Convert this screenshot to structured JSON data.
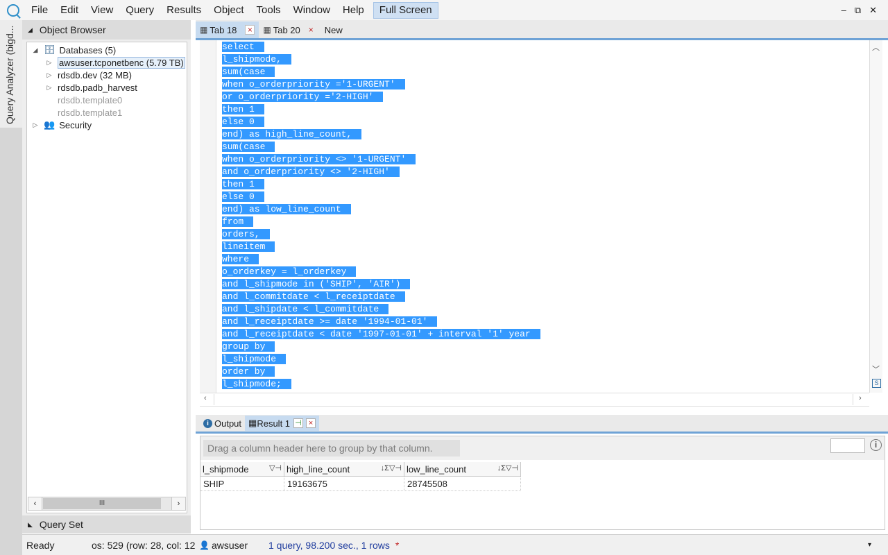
{
  "menu": {
    "items": [
      "File",
      "Edit",
      "View",
      "Query",
      "Results",
      "Object",
      "Tools",
      "Window",
      "Help"
    ],
    "fullscreen": "Full Screen",
    "win_controls": [
      "–",
      "⧉",
      "✕"
    ]
  },
  "sidebar_strip": {
    "label": "Query Analyzer (bigd..."
  },
  "object_browser": {
    "title": "Object Browser",
    "tree": [
      {
        "label": "Databases (5)",
        "expanded": true
      },
      {
        "label": "awsuser.tcponetbenc (5.79 TB)",
        "selected": true
      },
      {
        "label": "rdsdb.dev (32 MB)"
      },
      {
        "label": "rdsdb.padb_harvest"
      },
      {
        "label": "rdsdb.template0",
        "disabled": true
      },
      {
        "label": "rdsdb.template1",
        "disabled": true
      },
      {
        "label": "Security"
      }
    ],
    "scroll_thumb": "III"
  },
  "query_set": {
    "title": "Query Set"
  },
  "editor_tabs": {
    "tab1": "Tab 18",
    "tab2": "Tab 20",
    "new": "New"
  },
  "sql_lines": [
    "select",
    "l_shipmode,",
    "sum(case",
    "when o_orderpriority ='1-URGENT'",
    "or o_orderpriority ='2-HIGH'",
    "then 1",
    "else 0",
    "end) as high_line_count,",
    "sum(case",
    "when o_orderpriority <> '1-URGENT'",
    "and o_orderpriority <> '2-HIGH'",
    "then 1",
    "else 0",
    "end) as low_line_count",
    "from",
    "orders,",
    "lineitem",
    "where",
    "o_orderkey = l_orderkey",
    "and l_shipmode in ('SHIP', 'AIR')",
    "and l_commitdate < l_receiptdate",
    "and l_shipdate < l_commitdate",
    "and l_receiptdate >= date '1994-01-01'",
    "and l_receiptdate < date '1997-01-01' + interval '1' year",
    "group by",
    "l_shipmode",
    "order by",
    "l_shipmode;"
  ],
  "result_tabs": {
    "output": "Output",
    "result1": "Result 1"
  },
  "grid": {
    "group_hint": "Drag a column header here to group by that column.",
    "columns": [
      "l_shipmode",
      "high_line_count",
      "low_line_count"
    ],
    "rows": [
      [
        "SHIP",
        "19163675",
        "28745508"
      ]
    ]
  },
  "status": {
    "ready": "Ready",
    "position": "os: 529 (row: 28, col: 12",
    "user": "awsuser",
    "query_info": "1 query, 98.200 sec., 1 rows",
    "star": "*"
  }
}
